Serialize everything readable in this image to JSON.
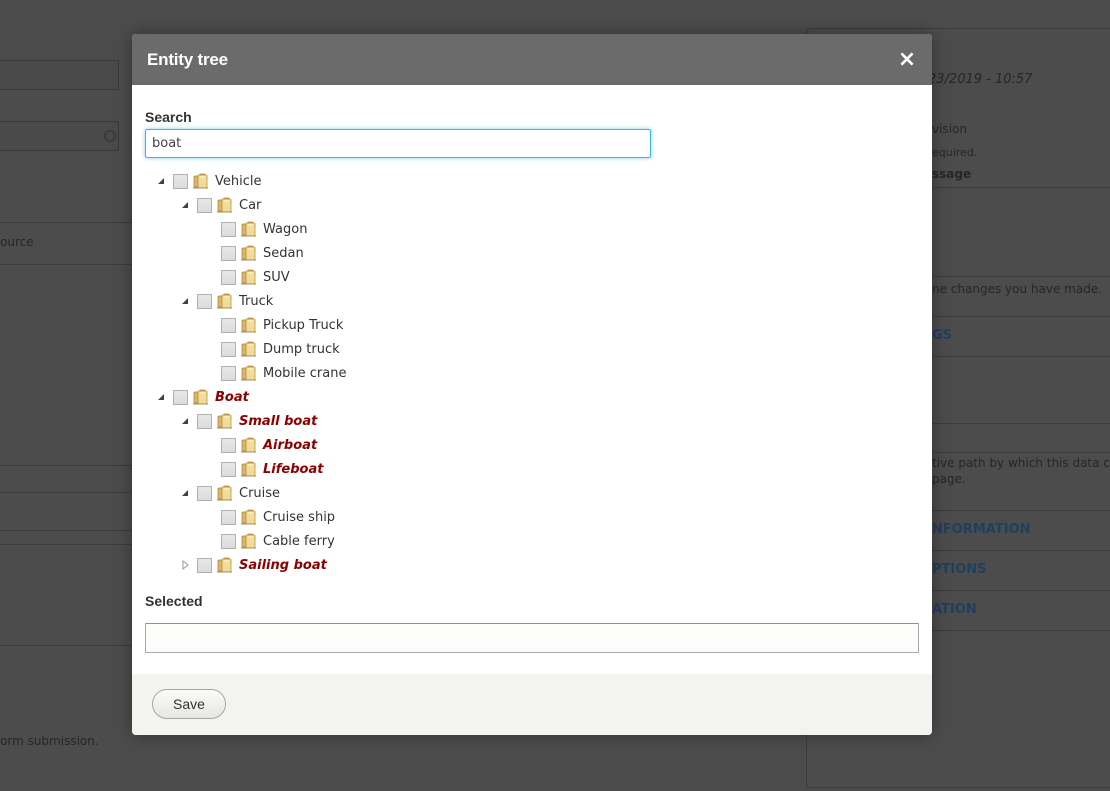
{
  "background": {
    "left_texts": [
      "ource",
      "orm submission."
    ],
    "right_texts": {
      "date": "23/2019 - 10:57",
      "revision": "vision",
      "required": "equired.",
      "message_heading": "ssage",
      "changes_note": "ne changes you have made.",
      "settings_link": "GS",
      "path_note_line1": "tive path by which this data c",
      "path_note_line2": "page.",
      "links": [
        "NFORMATION",
        "PTIONS",
        "ATION"
      ]
    }
  },
  "dialog": {
    "title": "Entity tree",
    "close_label": "×",
    "search": {
      "label": "Search",
      "value": "boat",
      "placeholder": ""
    },
    "tree": [
      {
        "label": "Vehicle",
        "level": 0,
        "toggle": "expanded",
        "match": false,
        "checked": false
      },
      {
        "label": "Car",
        "level": 1,
        "toggle": "expanded",
        "match": false,
        "checked": false
      },
      {
        "label": "Wagon",
        "level": 2,
        "toggle": "none",
        "match": false,
        "checked": false
      },
      {
        "label": "Sedan",
        "level": 2,
        "toggle": "none",
        "match": false,
        "checked": false
      },
      {
        "label": "SUV",
        "level": 2,
        "toggle": "none",
        "match": false,
        "checked": false
      },
      {
        "label": "Truck",
        "level": 1,
        "toggle": "expanded",
        "match": false,
        "checked": false
      },
      {
        "label": "Pickup Truck",
        "level": 2,
        "toggle": "none",
        "match": false,
        "checked": false
      },
      {
        "label": "Dump truck",
        "level": 2,
        "toggle": "none",
        "match": false,
        "checked": false
      },
      {
        "label": "Mobile crane",
        "level": 2,
        "toggle": "none",
        "match": false,
        "checked": false
      },
      {
        "label": "Boat",
        "level": 0,
        "toggle": "expanded",
        "match": true,
        "checked": false
      },
      {
        "label": "Small boat",
        "level": 1,
        "toggle": "expanded",
        "match": true,
        "checked": false
      },
      {
        "label": "Airboat",
        "level": 2,
        "toggle": "none",
        "match": true,
        "checked": false
      },
      {
        "label": "Lifeboat",
        "level": 2,
        "toggle": "none",
        "match": true,
        "checked": false
      },
      {
        "label": "Cruise",
        "level": 1,
        "toggle": "expanded",
        "match": false,
        "checked": false
      },
      {
        "label": "Cruise ship",
        "level": 2,
        "toggle": "none",
        "match": false,
        "checked": false
      },
      {
        "label": "Cable ferry",
        "level": 2,
        "toggle": "none",
        "match": false,
        "checked": false
      },
      {
        "label": "Sailing boat",
        "level": 1,
        "toggle": "collapsed",
        "match": true,
        "checked": false
      }
    ],
    "selected": {
      "label": "Selected",
      "value": ""
    },
    "save_label": "Save"
  },
  "colors": {
    "title_bar": "#6b6b6b",
    "match_text": "#8b0000",
    "focus_border": "#40b6e8",
    "footer_bg": "#f3f3ef"
  }
}
